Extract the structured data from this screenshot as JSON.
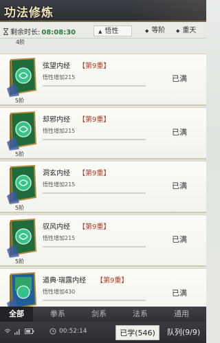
{
  "header": {
    "title": "功法修炼"
  },
  "filter": {
    "timer_label": "剩余时长:",
    "timer_value": "08:08:30",
    "sort_options": [
      {
        "label": "悟性",
        "active": true
      },
      {
        "label": "等阶",
        "active": false
      },
      {
        "label": "重天",
        "active": false
      }
    ]
  },
  "list": {
    "prev_tier": "4阶",
    "items": [
      {
        "name": "弦望内经",
        "level": "【第9重】",
        "effect": "悟性增加215",
        "tier": "5阶",
        "status": "已满"
      },
      {
        "name": "却邪内经",
        "level": "【第9重】",
        "effect": "悟性增加215",
        "tier": "5阶",
        "status": "已满"
      },
      {
        "name": "洞玄内经",
        "level": "【第9重】",
        "effect": "悟性增加215",
        "tier": "5阶",
        "status": "已满"
      },
      {
        "name": "驭风内经",
        "level": "【第9重】",
        "effect": "悟性增加215",
        "tier": "5阶",
        "status": "已满"
      },
      {
        "name": "道典·瑞露内经",
        "level": "【第9重】",
        "effect": "悟性增加430",
        "tier": "",
        "status": "已满"
      }
    ]
  },
  "categories": [
    "全部",
    "拳系",
    "剑系",
    "法系",
    "通用"
  ],
  "status_bar": {
    "time": "00:52:14",
    "learned": "已学(546)",
    "queue": "队列(9/9)"
  },
  "colors": {
    "accent_red": "#b23b1f",
    "timer_green": "#2f7a3a",
    "book_green": "#2f9a55"
  }
}
